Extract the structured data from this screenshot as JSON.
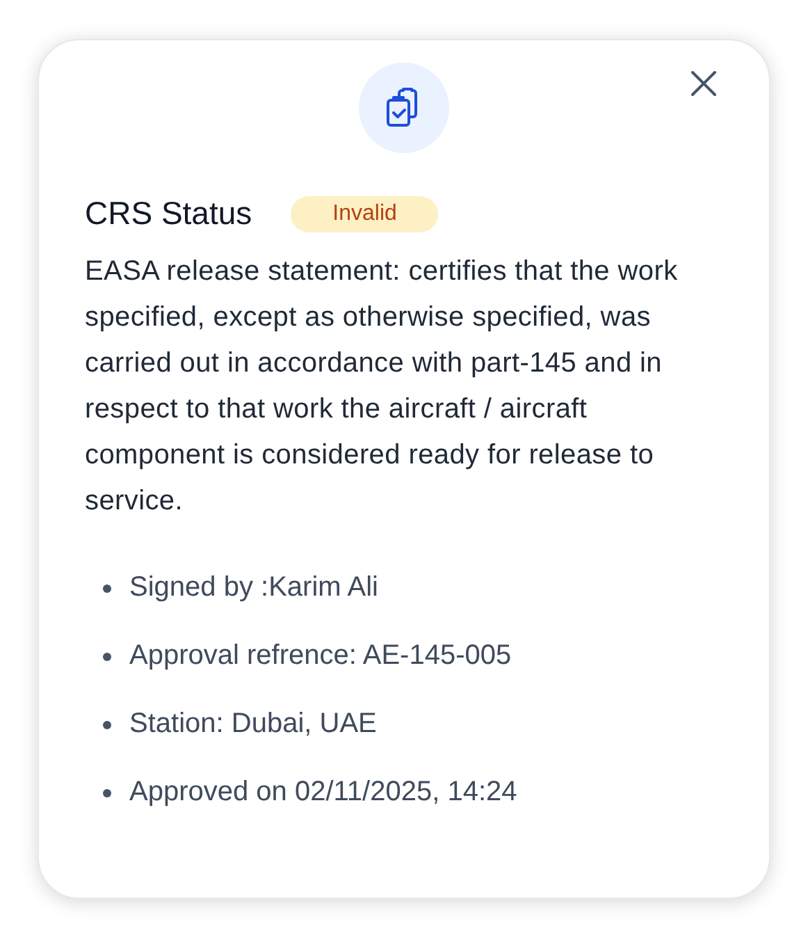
{
  "dialog": {
    "title": "CRS Status",
    "status": {
      "label": "Invalid",
      "kind": "invalid"
    },
    "statement": "EASA release statement: certifies that the work specified, except as otherwise specified, was carried out in accordance with part-145 and in respect to that work the aircraft / aircraft component is considered ready for release to service.",
    "details": [
      "Signed by :Karim Ali",
      "Approval refrence: AE-145-005",
      "Station: Dubai, UAE",
      "Approved on 02/11/2025, 14:24"
    ]
  }
}
